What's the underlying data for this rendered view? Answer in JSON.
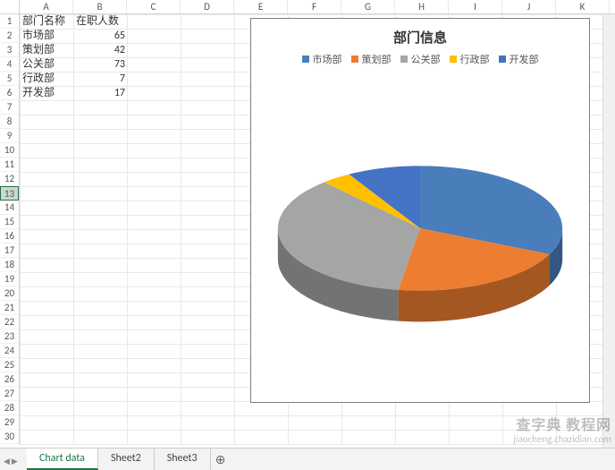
{
  "columns": [
    "A",
    "B",
    "C",
    "D",
    "E",
    "F",
    "G",
    "H",
    "I",
    "J",
    "K"
  ],
  "visible_row_numbers": [
    1,
    2,
    3,
    4,
    5,
    6,
    7,
    8,
    9,
    10,
    11,
    12,
    13,
    14,
    15,
    16,
    17,
    18,
    19,
    20,
    21,
    22,
    23,
    24,
    25,
    26,
    27,
    28,
    29,
    30
  ],
  "selected_row": 13,
  "table": {
    "headers": {
      "A": "部门名称",
      "B": "在职人数"
    },
    "rows": [
      {
        "A": "市场部",
        "B": 65
      },
      {
        "A": "策划部",
        "B": 42
      },
      {
        "A": "公关部",
        "B": 73
      },
      {
        "A": "行政部",
        "B": 7
      },
      {
        "A": "开发部",
        "B": 17
      }
    ]
  },
  "chart_data": {
    "type": "pie",
    "title": "部门信息",
    "series": [
      {
        "name": "市场部",
        "value": 65,
        "color": "#4A7EBB"
      },
      {
        "name": "策划部",
        "value": 42,
        "color": "#ED7D31"
      },
      {
        "name": "公关部",
        "value": 73,
        "color": "#A5A5A5"
      },
      {
        "name": "行政部",
        "value": 7,
        "color": "#FFC000"
      },
      {
        "name": "开发部",
        "value": 17,
        "color": "#4472C4"
      }
    ]
  },
  "tabs": {
    "items": [
      "Chart data",
      "Sheet2",
      "Sheet3"
    ],
    "active": 0,
    "newsheet_icon": "⊕"
  },
  "watermark": {
    "line1": "查字典  教程网",
    "line2": "jiaocheng.chazidian.com"
  }
}
